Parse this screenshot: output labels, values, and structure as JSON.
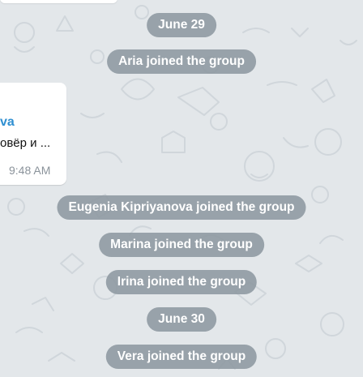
{
  "chat": {
    "service_messages": [
      {
        "text": "June 29"
      },
      {
        "text": "Aria joined the group"
      },
      {
        "text": "Eugenia Kipriyanova joined the group"
      },
      {
        "text": "Marina joined the group"
      },
      {
        "text": "Irina joined the group"
      },
      {
        "text": "June 30"
      },
      {
        "text": "Vera joined the group"
      }
    ],
    "message": {
      "sender": "va",
      "text": "овёр и ...",
      "time": "9:48 AM"
    }
  },
  "colors": {
    "background": "#e3e7ea",
    "pill": "#8d98a1",
    "sender": "#2f8fd1"
  },
  "icons": [
    "chat-background-pattern"
  ]
}
